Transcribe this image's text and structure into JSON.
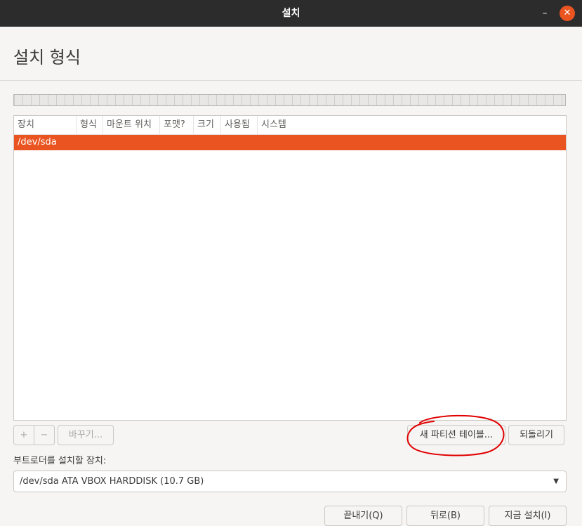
{
  "window": {
    "title": "설치",
    "minimize_glyph": "–",
    "close_glyph": "✕",
    "close_color": "#e95420"
  },
  "page": {
    "title": "설치 형식"
  },
  "table": {
    "columns": [
      "장치",
      "형식",
      "마운트 위치",
      "포맷?",
      "크기",
      "사용됨",
      "시스템"
    ],
    "rows": [
      {
        "device": "/dev/sda",
        "selected": true
      }
    ],
    "selection_color": "#e95420"
  },
  "toolbar": {
    "add_label": "+",
    "remove_label": "−",
    "change_label": "바꾸기...",
    "new_table_label": "새 파티션 테이블...",
    "revert_label": "되돌리기"
  },
  "bootloader": {
    "label": "부트로더를 설치할 장치:",
    "selected_value": "/dev/sda ATA VBOX HARDDISK (10.7 GB)",
    "arrow_icon": "chevron-down-icon"
  },
  "footer": {
    "quit_label": "끝내기(Q)",
    "back_label": "뒤로(B)",
    "install_label": "지금 설치(I)"
  },
  "annotation": {
    "color": "#e00000"
  }
}
